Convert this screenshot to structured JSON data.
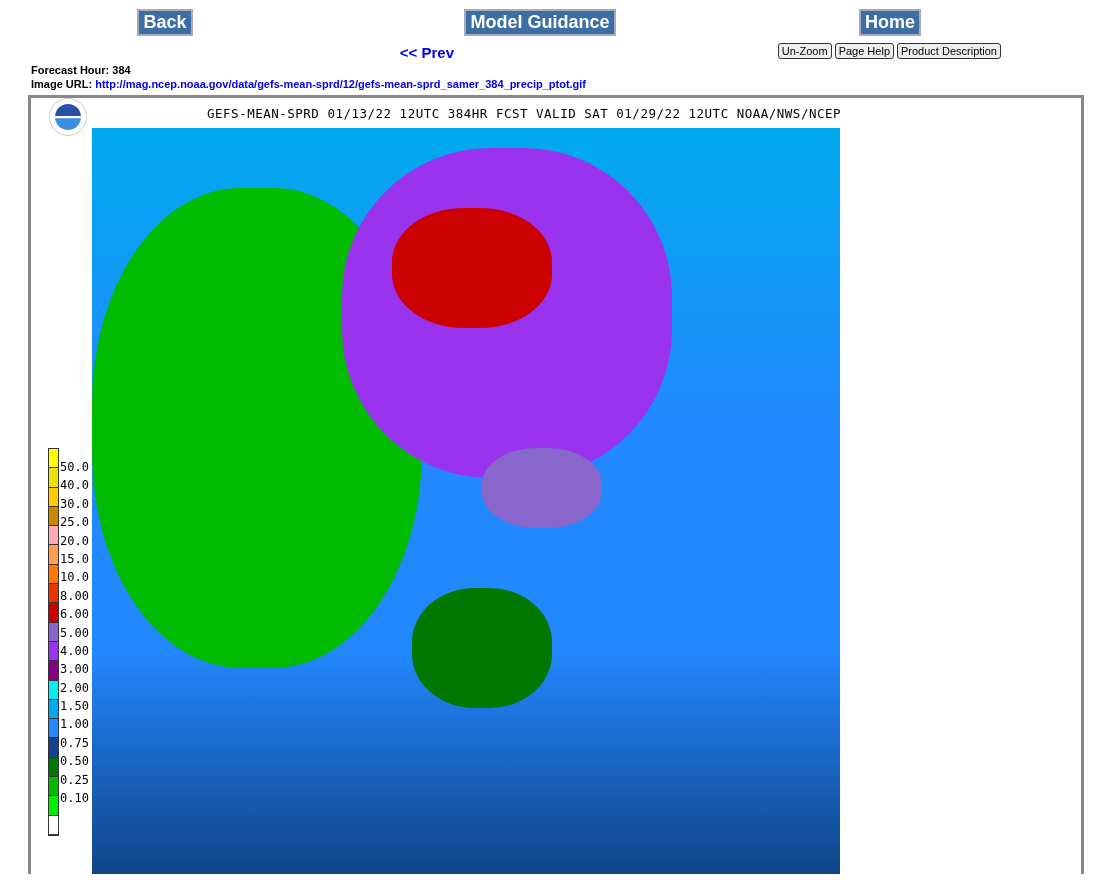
{
  "nav_buttons": [
    "Back",
    "Model Guidance",
    "Home"
  ],
  "prev_link": "<< Prev",
  "tool_buttons": [
    "Un-Zoom",
    "Page Help",
    "Product Description"
  ],
  "forecast_hour": {
    "label": "Forecast Hour:",
    "value": "384"
  },
  "image_url": {
    "label": "Image URL:",
    "url": "http://mag.ncep.noaa.gov/data/gefs-mean-sprd/12/gefs-mean-sprd_samer_384_precip_ptot.gif"
  },
  "map": {
    "title": "GEFS-MEAN-SPRD 01/13/22 12UTC 384HR FCST VALID SAT 01/29/22 12UTC NOAA/NWS/NCEP",
    "legend": [
      {
        "color": "#ffff00",
        "label": "50.0"
      },
      {
        "color": "#eee000",
        "label": "40.0"
      },
      {
        "color": "#ffcc00",
        "label": "30.0"
      },
      {
        "color": "#cc8800",
        "label": "25.0"
      },
      {
        "color": "#ffaabb",
        "label": "20.0"
      },
      {
        "color": "#ffa050",
        "label": "15.0"
      },
      {
        "color": "#ff7700",
        "label": "10.0"
      },
      {
        "color": "#ee3300",
        "label": "8.00"
      },
      {
        "color": "#cc0000",
        "label": "6.00"
      },
      {
        "color": "#8866cc",
        "label": "5.00"
      },
      {
        "color": "#9933ee",
        "label": "4.00"
      },
      {
        "color": "#880088",
        "label": "3.00"
      },
      {
        "color": "#00eeee",
        "label": "2.00"
      },
      {
        "color": "#00aaee",
        "label": "1.50"
      },
      {
        "color": "#2288ff",
        "label": "1.00"
      },
      {
        "color": "#114488",
        "label": "0.75"
      },
      {
        "color": "#007700",
        "label": "0.50"
      },
      {
        "color": "#00bb00",
        "label": "0.25"
      },
      {
        "color": "#00ee00",
        "label": "0.10"
      },
      {
        "color": "#ffffff"
      }
    ]
  }
}
